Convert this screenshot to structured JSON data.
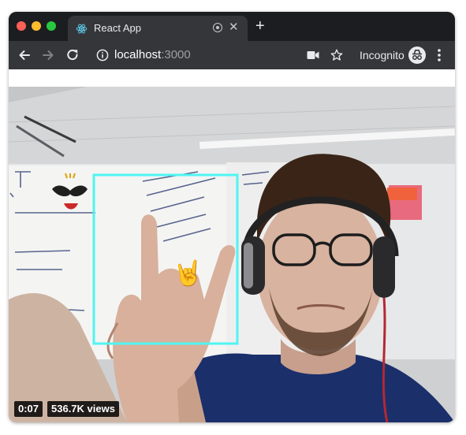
{
  "browser": {
    "tab": {
      "title": "React App",
      "favicon": "react-logo-icon",
      "close_glyph": "✕"
    },
    "new_tab_glyph": "+",
    "address": {
      "host": "localhost",
      "port": ":3000"
    },
    "profile_label": "Incognito"
  },
  "video": {
    "detection_label": "🤘",
    "overlay_color": "#4ff5f2",
    "duration": "0:07",
    "views": "536.7K views"
  },
  "colors": {
    "tab_bar": "#1c1d20",
    "toolbar": "#35363a",
    "text": "#e8eaed"
  }
}
